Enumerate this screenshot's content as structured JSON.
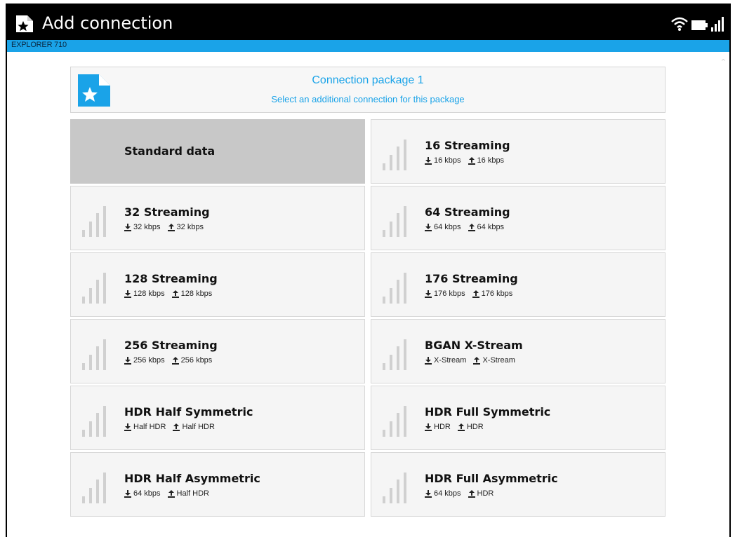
{
  "titlebar": {
    "title": "Add connection",
    "icon": "star-document-icon",
    "status_icons": [
      "wifi-icon",
      "battery-icon",
      "signal-icon"
    ]
  },
  "subbar": {
    "device_name": "EXPLORER 710"
  },
  "package": {
    "icon": "star-document-icon",
    "title": "Connection package 1",
    "subtitle": "Select an additional connection for this package"
  },
  "tiles": [
    {
      "name": "Standard data",
      "down": "",
      "up": "",
      "selected": true
    },
    {
      "name": "16 Streaming",
      "down": "16 kbps",
      "up": "16 kbps",
      "selected": false
    },
    {
      "name": "32 Streaming",
      "down": "32 kbps",
      "up": "32 kbps",
      "selected": false
    },
    {
      "name": "64 Streaming",
      "down": "64 kbps",
      "up": "64 kbps",
      "selected": false
    },
    {
      "name": "128 Streaming",
      "down": "128 kbps",
      "up": "128 kbps",
      "selected": false
    },
    {
      "name": "176 Streaming",
      "down": "176 kbps",
      "up": "176 kbps",
      "selected": false
    },
    {
      "name": "256 Streaming",
      "down": "256 kbps",
      "up": "256 kbps",
      "selected": false
    },
    {
      "name": "BGAN X-Stream",
      "down": "X-Stream",
      "up": "X-Stream",
      "selected": false
    },
    {
      "name": "HDR Half Symmetric",
      "down": "Half HDR",
      "up": "Half HDR",
      "selected": false
    },
    {
      "name": "HDR Full Symmetric",
      "down": "HDR",
      "up": "HDR",
      "selected": false
    },
    {
      "name": "HDR Half Asymmetric",
      "down": "64 kbps",
      "up": "Half HDR",
      "selected": false
    },
    {
      "name": "HDR Full Asymmetric",
      "down": "64 kbps",
      "up": "HDR",
      "selected": false
    }
  ],
  "colors": {
    "accent": "#1aa3e8",
    "titlebar": "#000000",
    "tile_bg": "#f5f5f5",
    "tile_selected_bg": "#c8c8c8",
    "bars": "#d0d0d0"
  }
}
